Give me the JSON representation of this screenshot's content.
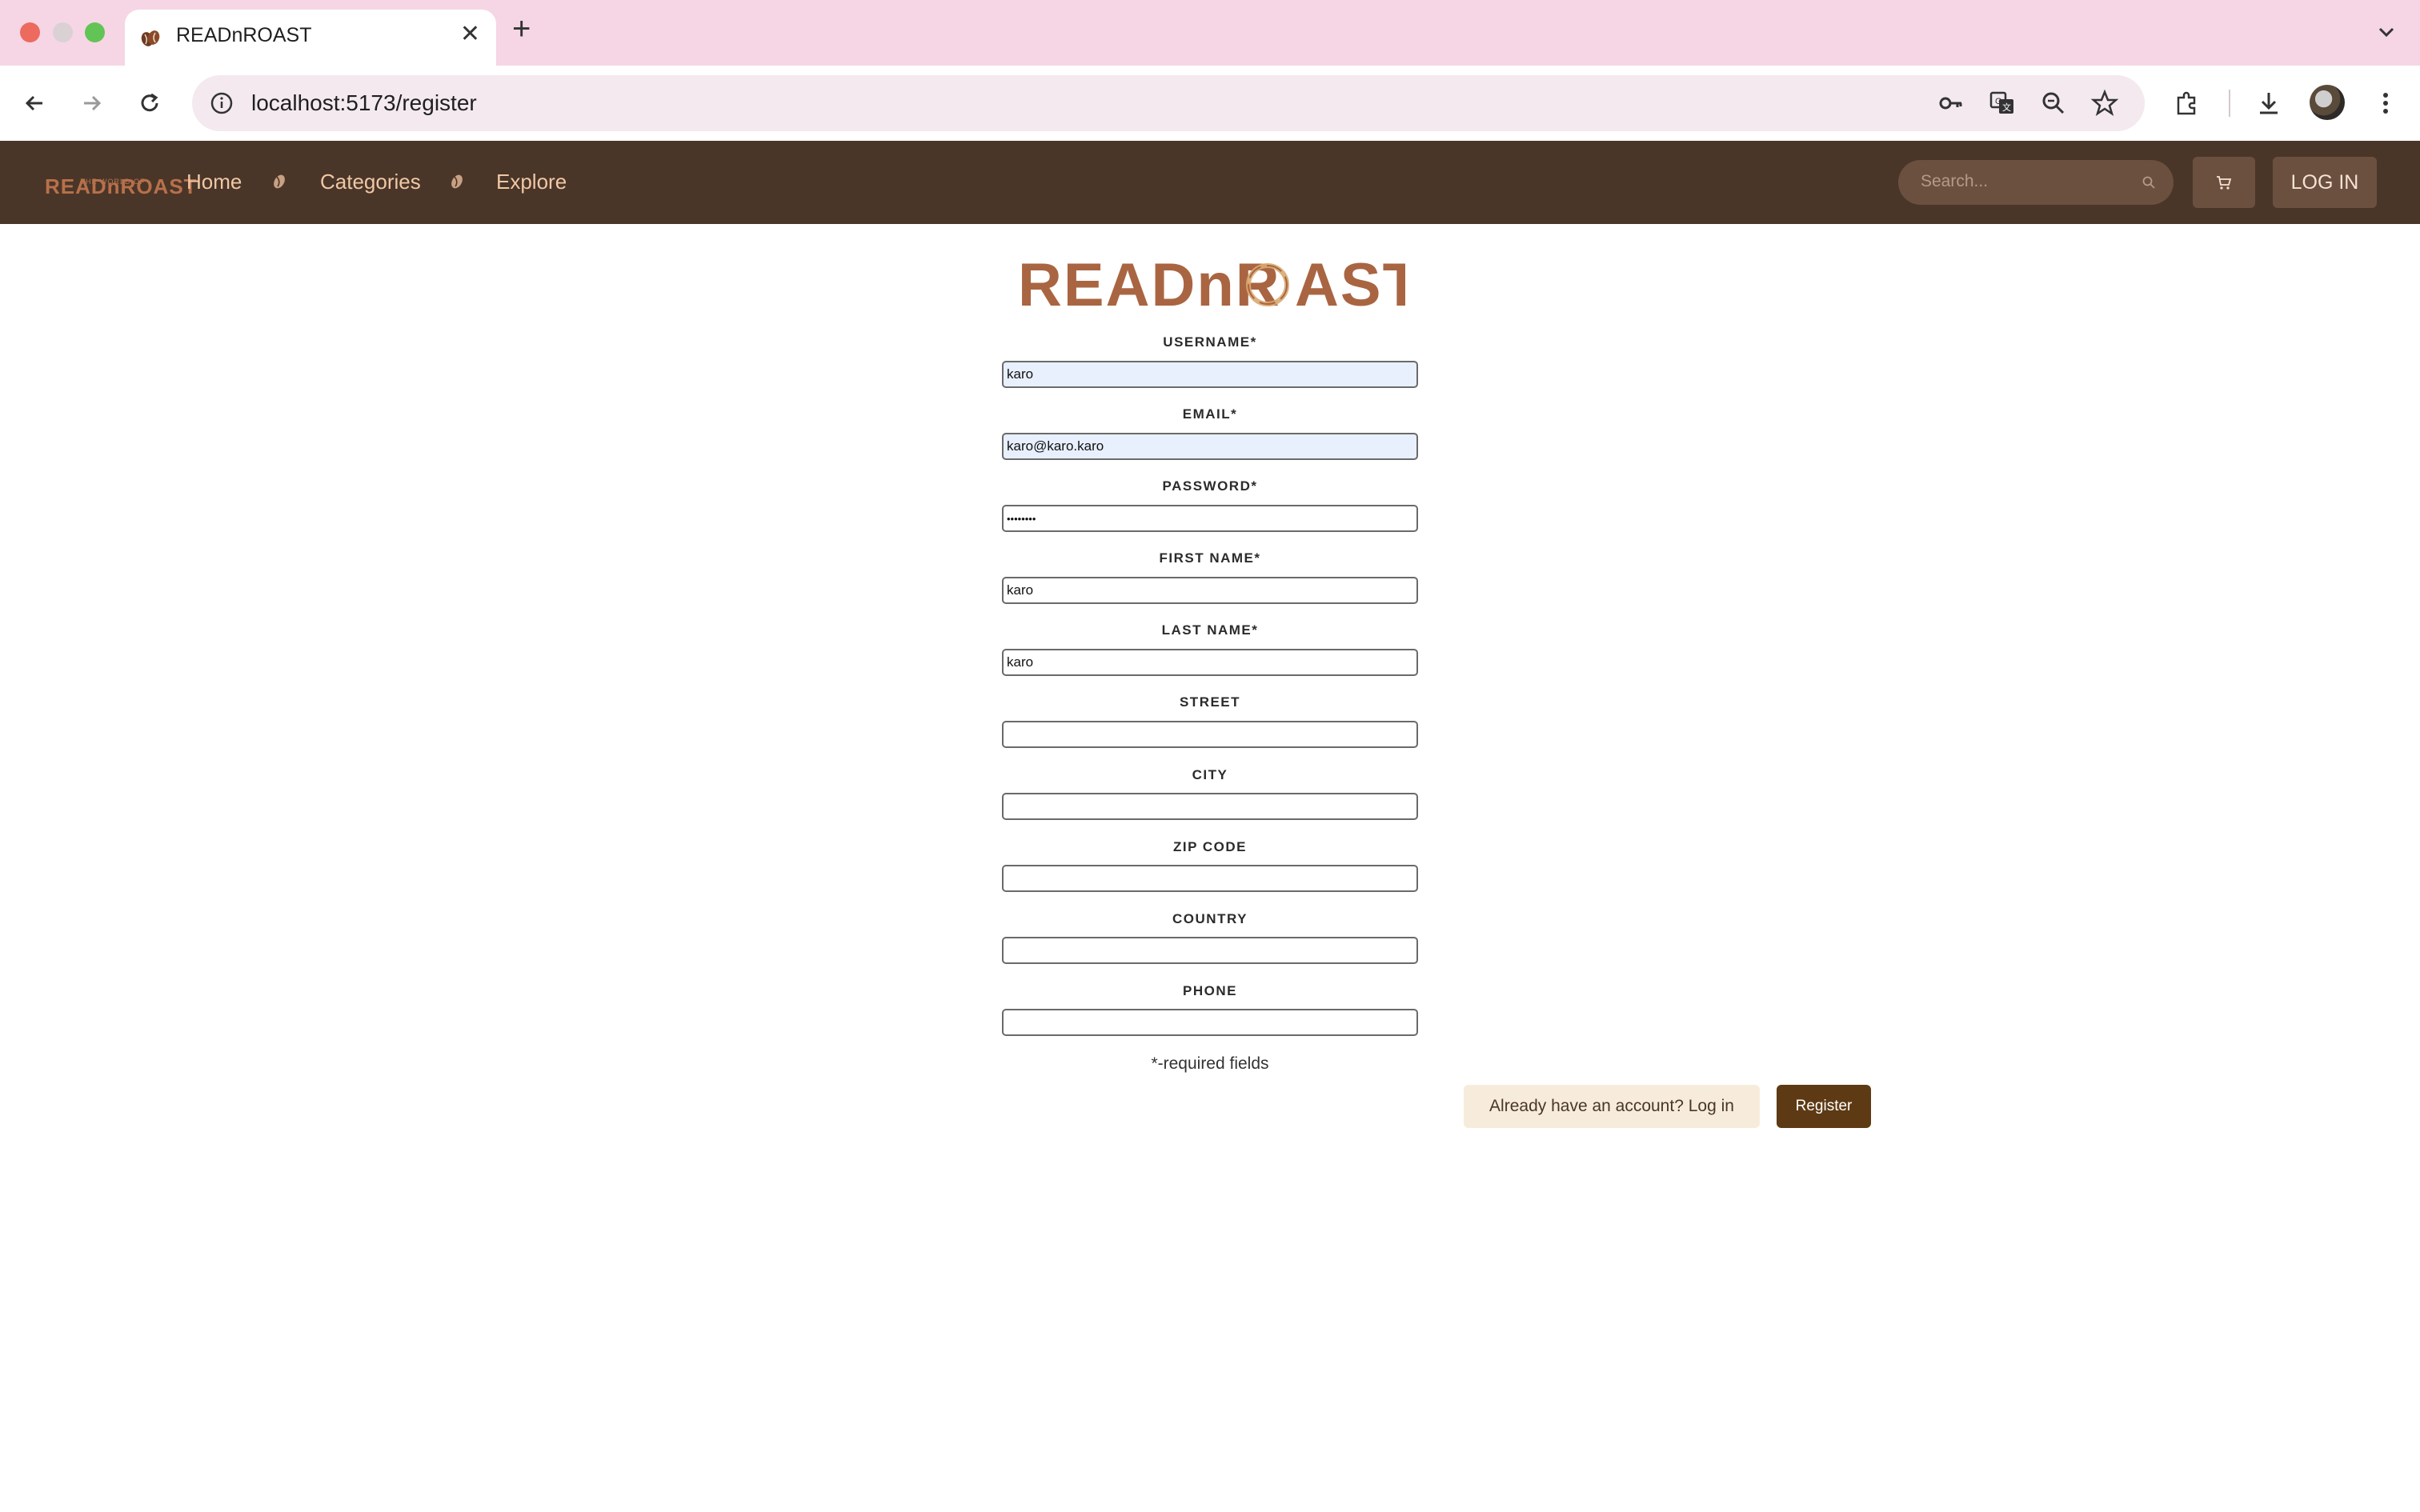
{
  "browser": {
    "tab_title": "READnROAST",
    "url": "localhost:5173/register"
  },
  "site": {
    "brand_tagline": "THE WORLD OF",
    "brand_name": "READnROAST",
    "nav": [
      {
        "label": "Home"
      },
      {
        "label": "Categories"
      },
      {
        "label": "Explore"
      }
    ],
    "search_placeholder": "Search...",
    "login_label": "LOG IN"
  },
  "form": {
    "logo_text_left": "READnR",
    "logo_text_right": "AST",
    "fields": [
      {
        "label": "USERNAME*",
        "value": "karo",
        "autofill": true
      },
      {
        "label": "EMAIL*",
        "value": "karo@karo.karo",
        "autofill": true
      },
      {
        "label": "PASSWORD*",
        "value": "••••••••",
        "autofill": false
      },
      {
        "label": "FIRST NAME*",
        "value": "karo",
        "autofill": false
      },
      {
        "label": "LAST NAME*",
        "value": "karo",
        "autofill": false
      },
      {
        "label": "STREET",
        "value": "",
        "autofill": false
      },
      {
        "label": "CITY",
        "value": "",
        "autofill": false
      },
      {
        "label": "ZIP CODE",
        "value": "",
        "autofill": false
      },
      {
        "label": "COUNTRY",
        "value": "",
        "autofill": false
      },
      {
        "label": "PHONE",
        "value": "",
        "autofill": false
      }
    ],
    "required_note": "*-required fields",
    "login_link": "Already have an account? Log in",
    "register_label": "Register"
  },
  "colors": {
    "header_bg": "#4a3628",
    "accent": "#a96542",
    "register_bg": "#5d3a14",
    "tabbar_bg": "#f6d6e4"
  }
}
